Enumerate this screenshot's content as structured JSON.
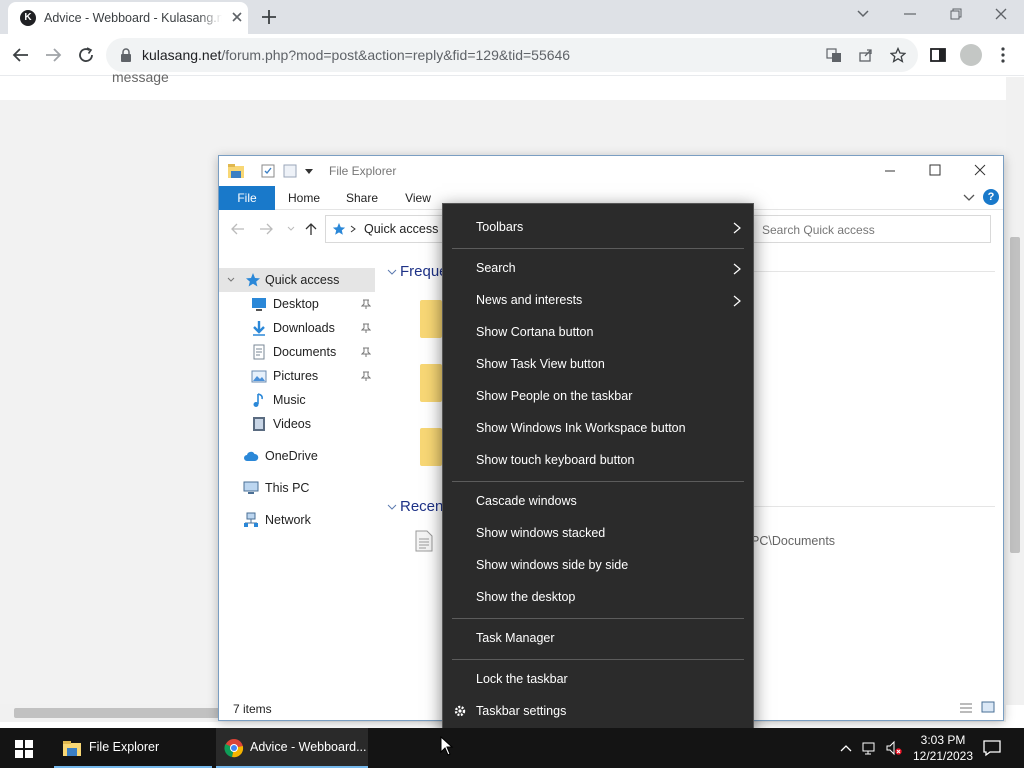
{
  "browser": {
    "tab_title": "Advice - Webboard - Kulasang.net",
    "tab_favicon_letter": "K",
    "url_host": "kulasang.net",
    "url_path": "/forum.php?mod=post&action=reply&fid=129&tid=55646"
  },
  "page": {
    "message_fragment": "message"
  },
  "explorer": {
    "title": "File Explorer",
    "ribbon_tabs": [
      "File",
      "Home",
      "Share",
      "View"
    ],
    "address": "Quick access",
    "search_placeholder": "Search Quick access",
    "nav": [
      {
        "label": "Quick access",
        "icon": "star-icon"
      },
      {
        "label": "Desktop",
        "icon": "desktop-icon",
        "pinned": true
      },
      {
        "label": "Downloads",
        "icon": "download-icon",
        "pinned": true
      },
      {
        "label": "Documents",
        "icon": "documents-icon",
        "pinned": true
      },
      {
        "label": "Pictures",
        "icon": "pictures-icon",
        "pinned": true
      },
      {
        "label": "Music",
        "icon": "music-icon"
      },
      {
        "label": "Videos",
        "icon": "videos-icon"
      },
      {
        "label": "OneDrive",
        "icon": "cloud-icon"
      },
      {
        "label": "This PC",
        "icon": "computer-icon"
      },
      {
        "label": "Network",
        "icon": "network-icon"
      }
    ],
    "section_frequent": "Frequent folders",
    "section_recent": "Recent files",
    "recent_path_fragment": "PC\\Documents",
    "status": "7 items"
  },
  "context_menu": {
    "items": [
      {
        "label": "Toolbars",
        "submenu": true
      },
      {
        "label": "Search",
        "submenu": true
      },
      {
        "label": "News and interests",
        "submenu": true
      },
      {
        "label": "Show Cortana button"
      },
      {
        "label": "Show Task View button"
      },
      {
        "label": "Show People on the taskbar"
      },
      {
        "label": "Show Windows Ink Workspace button"
      },
      {
        "label": "Show touch keyboard button"
      },
      {
        "label": "Cascade windows"
      },
      {
        "label": "Show windows stacked"
      },
      {
        "label": "Show windows side by side"
      },
      {
        "label": "Show the desktop"
      },
      {
        "label": "Task Manager"
      },
      {
        "label": "Lock the taskbar"
      },
      {
        "label": "Taskbar settings",
        "icon": "gear-icon"
      }
    ]
  },
  "taskbar": {
    "apps": [
      {
        "label": "File Explorer",
        "icon": "file-explorer-icon"
      },
      {
        "label": "Advice - Webboard...",
        "icon": "chrome-icon"
      }
    ],
    "time": "3:03 PM",
    "date": "12/21/2023"
  }
}
